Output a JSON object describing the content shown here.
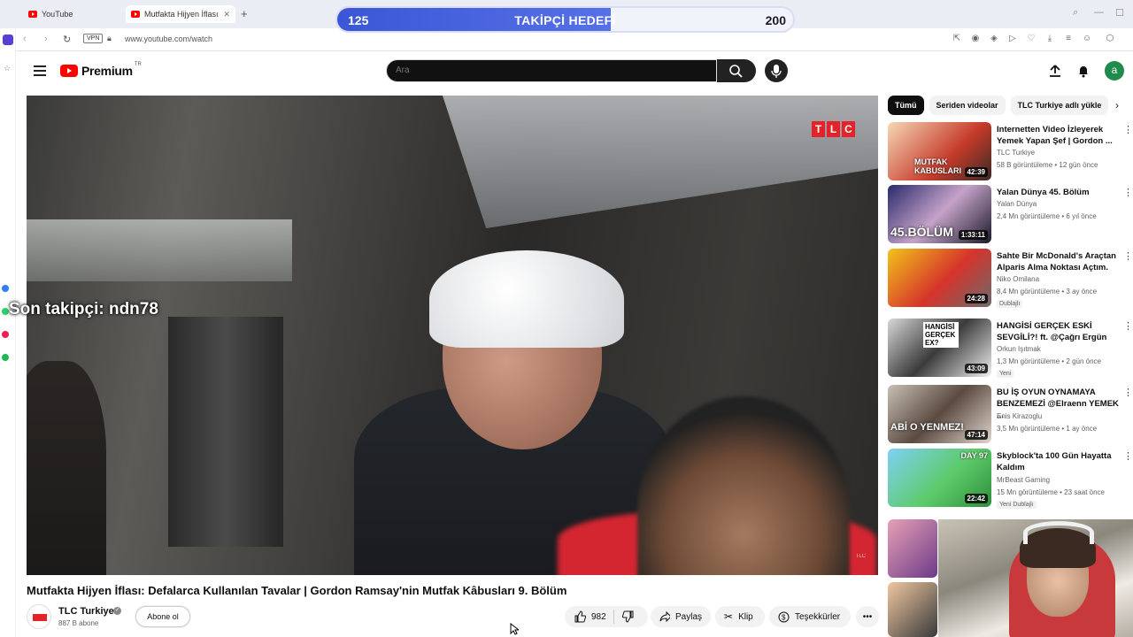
{
  "browser": {
    "tabs": [
      {
        "label": "YouTube"
      },
      {
        "label": "Mutfakta Hijyen İflası"
      }
    ],
    "url": "www.youtube.com/watch",
    "vpn_label": "VPN"
  },
  "overlay": {
    "goal_start": "125",
    "goal_title": "TAKİPÇİ HEDEFİ",
    "goal_end": "200",
    "last_follower": "Son takipçi: ndn78"
  },
  "youtube": {
    "logo_text": "Premium",
    "logo_country": "TR",
    "search_placeholder": "Ara",
    "avatar_letter": "a"
  },
  "video": {
    "title": "Mutfakta Hijyen İflası: Defalarca Kullanılan Tavalar | Gordon Ramsay'nin Mutfak Kâbusları 9. Bölüm",
    "watermark": "TLC",
    "channel": "TLC Turkiye",
    "subscribers": "887 B abone",
    "subscribe_label": "Abone ol",
    "likes": "982",
    "share_label": "Paylaş",
    "clip_label": "Klip",
    "thanks_label": "Teşekkürler"
  },
  "sidebar": {
    "chips": [
      "Tümü",
      "Seriden videolar",
      "TLC Turkiye adlı yükle"
    ],
    "recommendations": [
      {
        "title": "Internetten Video İzleyerek Yemek Yapan Şef | Gordon ...",
        "channel": "TLC Turkiye",
        "meta": "58 B görüntüleme • 12 gün önce",
        "duration": "42:39",
        "badge": ""
      },
      {
        "title": "Yalan Dünya 45. Bölüm",
        "channel": "Yalan Dünya",
        "meta": "2,4 Mn görüntüleme • 6 yıl önce",
        "duration": "1:33:11",
        "badge": ""
      },
      {
        "title": "Sahte Bir McDonald's Araçtan Alparis Alma Noktası Açtım.",
        "channel": "Niko Omilana",
        "meta": "8,4 Mn görüntüleme • 3 ay önce",
        "duration": "24:28",
        "badge": "Dublajlı"
      },
      {
        "title": "HANGİSİ GERÇEK ESKİ SEVGİLİ?! ft. @Çağrı Ergün",
        "channel": "Orkun Işıtmak",
        "meta": "1,3 Mn görüntüleme • 2 gün önce",
        "duration": "43:09",
        "badge": "Yeni"
      },
      {
        "title": "BU İŞ OYUN OYNAMAYA BENZEMEZİ @Elraenn YEMEK ...",
        "channel": "Enis Kirazoglu",
        "meta": "3,5 Mn görüntüleme • 1 ay önce",
        "duration": "47:14",
        "badge": ""
      },
      {
        "title": "Skyblock'ta 100 Gün Hayatta Kaldım",
        "channel": "MrBeast Gaming",
        "meta": "15 Mn görüntüleme • 23 saat önce",
        "duration": "22:42",
        "badge": "Yeni  Dublajlı"
      }
    ],
    "thumb_text": [
      "MUTFAK KABUSLARI",
      "45.BÖLÜM",
      "",
      "HANGİSİ GERÇEK EX?",
      "ABİ O YENMEZ!",
      "DAY 97"
    ]
  },
  "colors": {
    "youtube_red": "#ff0000",
    "goal_fill": "#3b57d6",
    "tlc_red": "#e32329"
  },
  "goal_progress": 0.6
}
